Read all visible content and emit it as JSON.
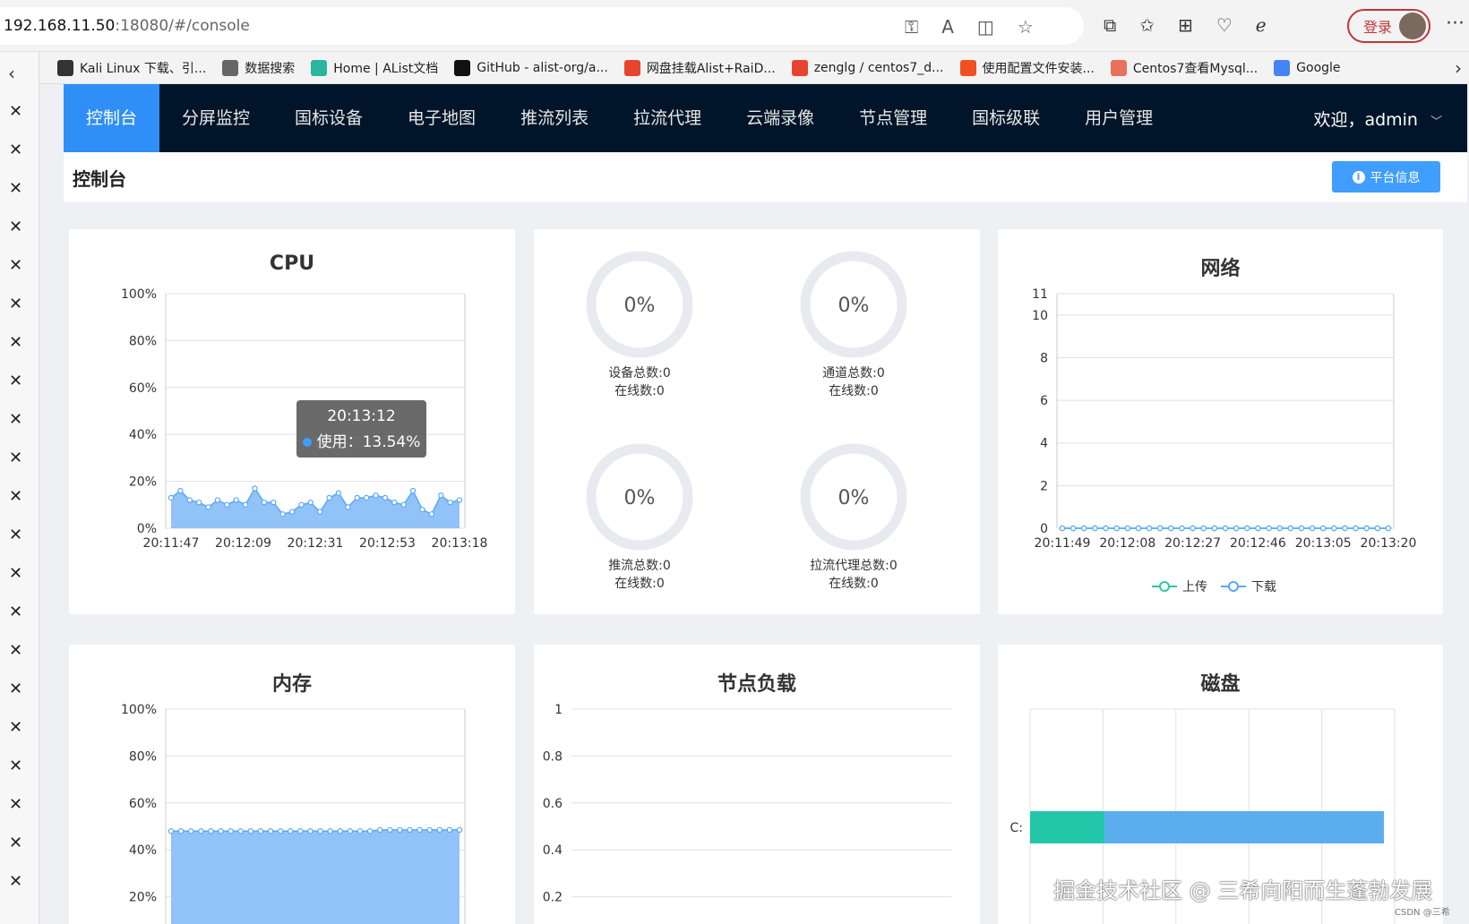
{
  "browser": {
    "url_host": "192.168.11.50",
    "url_path": ":18080/#/console",
    "login_label": "登录",
    "bookmarks": [
      {
        "label": "Kali Linux 下载、引...",
        "icon": "kali-icon",
        "color": "#333"
      },
      {
        "label": "数据搜索",
        "icon": "document-icon",
        "color": "#666"
      },
      {
        "label": "Home | AList文档",
        "icon": "alist-icon",
        "color": "#2bb5a0"
      },
      {
        "label": "GitHub - alist-org/a...",
        "icon": "github-icon",
        "color": "#111"
      },
      {
        "label": "网盘挂载Alist+RaiD...",
        "icon": "csdn-icon",
        "color": "#e8442d"
      },
      {
        "label": "zenglg / centos7_d...",
        "icon": "gitee-icon",
        "color": "#e8442d"
      },
      {
        "label": "使用配置文件安装...",
        "icon": "microsoft-icon",
        "color": "#f25022"
      },
      {
        "label": "Centos7查看Mysql...",
        "icon": "jianshu-icon",
        "color": "#e9715b"
      },
      {
        "label": "Google",
        "icon": "google-icon",
        "color": "#4285f4"
      }
    ]
  },
  "nav": {
    "items": [
      "控制台",
      "分屏监控",
      "国标设备",
      "电子地图",
      "推流列表",
      "拉流代理",
      "云端录像",
      "节点管理",
      "国标级联",
      "用户管理"
    ],
    "active_index": 0,
    "user": "欢迎，admin"
  },
  "page": {
    "title": "控制台",
    "platform_button": "平台信息"
  },
  "cards": {
    "cpu_title": "CPU",
    "network_title": "网络",
    "memory_title": "内存",
    "node_load_title": "节点负载",
    "disk_title": "磁盘"
  },
  "stats": [
    {
      "percent": "0%",
      "line1": "设备总数:0",
      "line2": "在线数:0"
    },
    {
      "percent": "0%",
      "line1": "通道总数:0",
      "line2": "在线数:0"
    },
    {
      "percent": "0%",
      "line1": "推流总数:0",
      "line2": "在线数:0"
    },
    {
      "percent": "0%",
      "line1": "拉流代理总数:0",
      "line2": "在线数:0"
    }
  ],
  "tooltip": {
    "time": "20:13:12",
    "label": "使用：13.54%"
  },
  "watermark": "掘金技术社区 @ 三希向阳而生蓬勃发展",
  "csdn_mark": "CSDN @三希",
  "colors": {
    "accent": "#2f8ff7",
    "nav_bg": "#001529",
    "area": "#5aa7f5",
    "teal": "#22c7a9"
  },
  "chart_data": [
    {
      "type": "area",
      "title": "CPU",
      "y_ticks": [
        "100%",
        "80%",
        "60%",
        "40%",
        "20%",
        "0%"
      ],
      "x_ticks": [
        "20:11:47",
        "20:12:09",
        "20:12:31",
        "20:12:53",
        "20:13:18"
      ],
      "ylim": [
        0,
        100
      ],
      "values": [
        13,
        16,
        12,
        11,
        9,
        12,
        10,
        12,
        10,
        17,
        11,
        11,
        6,
        7,
        10,
        11,
        7,
        13,
        15,
        9,
        13,
        13,
        14,
        13,
        11,
        10,
        16,
        8,
        6,
        14,
        11,
        12
      ]
    },
    {
      "type": "line",
      "title": "网络",
      "y_ticks": [
        "11",
        "10",
        "8",
        "6",
        "4",
        "2",
        "0"
      ],
      "x_ticks": [
        "20:11:49",
        "20:12:08",
        "20:12:27",
        "20:12:46",
        "20:13:05",
        "20:13:20"
      ],
      "ylim": [
        0,
        11
      ],
      "series": [
        {
          "name": "上传",
          "color": "#2ec7a5",
          "values": [
            0,
            0,
            0,
            0,
            0,
            0,
            0,
            0,
            0,
            0,
            0,
            0,
            0,
            0,
            0,
            0,
            0,
            0,
            0,
            0,
            0,
            0,
            0,
            0,
            0,
            0,
            0,
            0,
            0,
            0,
            0
          ]
        },
        {
          "name": "下载",
          "color": "#5aa7f5",
          "values": [
            0,
            0,
            0,
            0,
            0,
            0,
            0,
            0,
            0,
            0,
            0,
            0,
            0,
            0,
            0,
            0,
            0,
            0,
            0,
            0,
            0,
            0,
            0,
            0,
            0,
            0,
            0,
            0,
            0,
            0,
            0
          ]
        }
      ]
    },
    {
      "type": "area",
      "title": "内存",
      "y_ticks": [
        "100%",
        "80%",
        "60%",
        "40%",
        "20%"
      ],
      "ylim": [
        0,
        100
      ],
      "values": [
        48,
        48,
        48,
        48,
        48,
        48,
        48,
        48,
        48,
        48,
        48,
        48,
        48,
        48,
        48,
        48,
        48,
        48,
        48,
        48,
        48,
        48.5,
        48.5,
        48.5,
        48.5,
        48.5,
        48.5,
        48.5,
        48.5,
        48.5
      ]
    },
    {
      "type": "line",
      "title": "节点负载",
      "y_ticks": [
        "1",
        "0.8",
        "0.6",
        "0.4",
        "0.2"
      ],
      "ylim": [
        0,
        1
      ]
    },
    {
      "type": "bar",
      "title": "磁盘",
      "categories": [
        "C:"
      ],
      "used_fraction": 0.21
    }
  ]
}
